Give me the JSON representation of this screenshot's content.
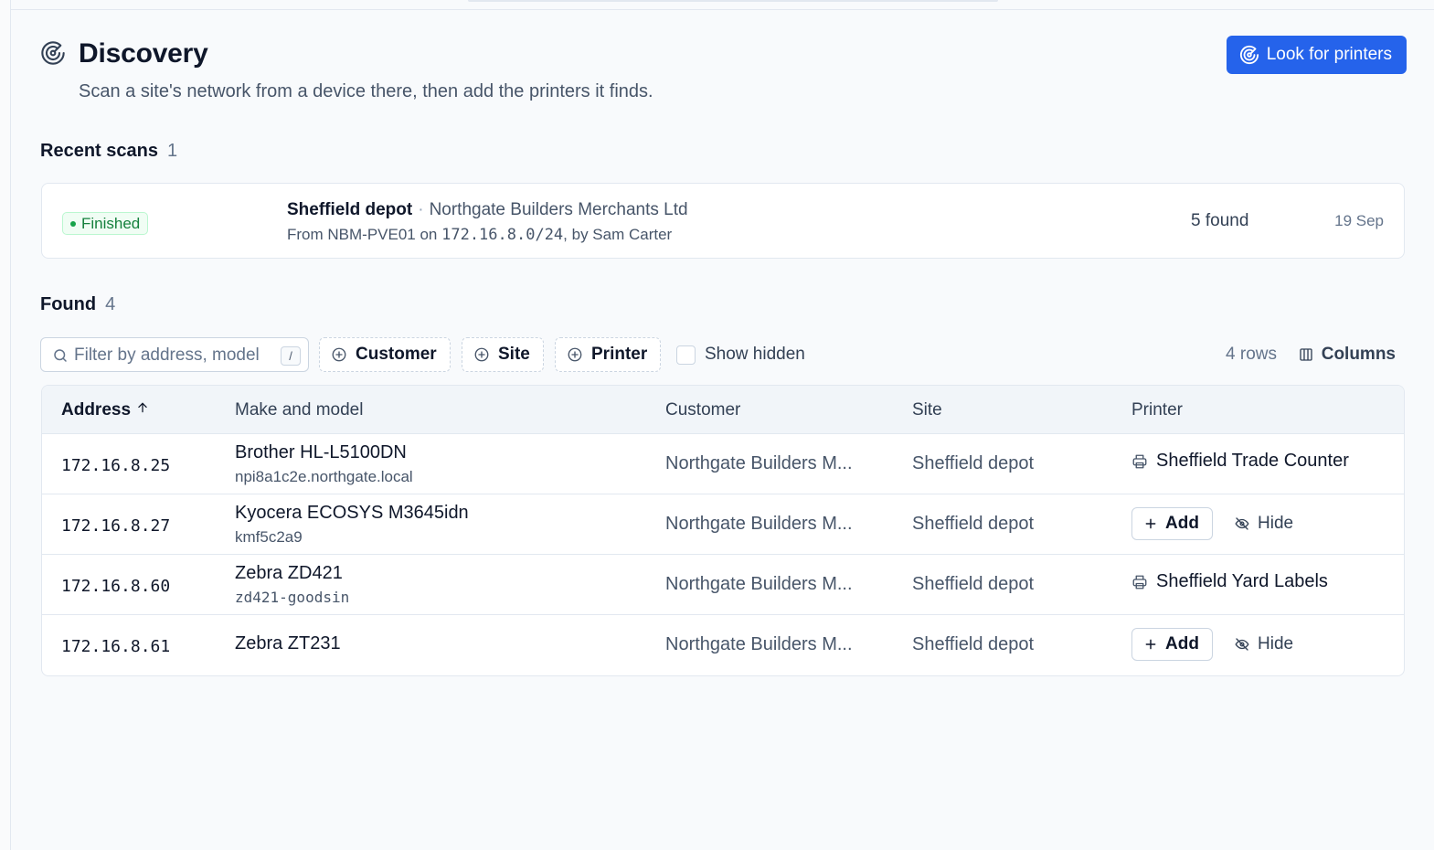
{
  "header": {
    "title": "Discovery",
    "subtitle": "Scan a site's network from a device there, then add the printers it finds.",
    "primary_action": "Look for printers"
  },
  "recent_scans": {
    "label": "Recent scans",
    "count": "1",
    "items": [
      {
        "status": "Finished",
        "site": "Sheffield depot",
        "separator": "·",
        "customer": "Northgate Builders Merchants Ltd",
        "detail_prefix": "From NBM-PVE01 on ",
        "subnet": "172.16.8.0/24",
        "detail_suffix": ", by Sam Carter",
        "found": "5 found",
        "date": "19 Sep"
      }
    ]
  },
  "found": {
    "label": "Found",
    "count": "4",
    "search_placeholder": "Filter by address, model",
    "search_shortcut": "/",
    "filters": [
      "Customer",
      "Site",
      "Printer"
    ],
    "show_hidden_label": "Show hidden",
    "rows_count": "4 rows",
    "columns_label": "Columns",
    "headers": {
      "address": "Address",
      "model": "Make and model",
      "customer": "Customer",
      "site": "Site",
      "printer": "Printer"
    },
    "rows": [
      {
        "address": "172.16.8.25",
        "model": "Brother HL-L5100DN",
        "host": "npi8a1c2e.northgate.local",
        "customer": "Northgate Builders M...",
        "site": "Sheffield depot",
        "printer": "Sheffield Trade Counter"
      },
      {
        "address": "172.16.8.27",
        "model": "Kyocera ECOSYS M3645idn",
        "host": "kmf5c2a9",
        "customer": "Northgate Builders M...",
        "site": "Sheffield depot",
        "add_label": "Add",
        "hide_label": "Hide"
      },
      {
        "address": "172.16.8.60",
        "model": "Zebra ZD421",
        "host": "zd421-goodsin",
        "customer": "Northgate Builders M...",
        "site": "Sheffield depot",
        "printer": "Sheffield Yard Labels"
      },
      {
        "address": "172.16.8.61",
        "model": "Zebra ZT231",
        "customer": "Northgate Builders M...",
        "site": "Sheffield depot",
        "add_label": "Add",
        "hide_label": "Hide"
      }
    ]
  },
  "colors": {
    "primary": "#2563eb",
    "status_finished": "#15803d",
    "background": "#f8fafc",
    "border": "#e2e8f0"
  },
  "icons": {
    "header": "radar-icon",
    "search": "search-icon",
    "filter": "plus-circle-icon",
    "columns": "columns-icon",
    "sort": "arrow-up-icon",
    "printer": "printer-icon",
    "add": "plus-icon",
    "hide": "eye-off-icon"
  }
}
